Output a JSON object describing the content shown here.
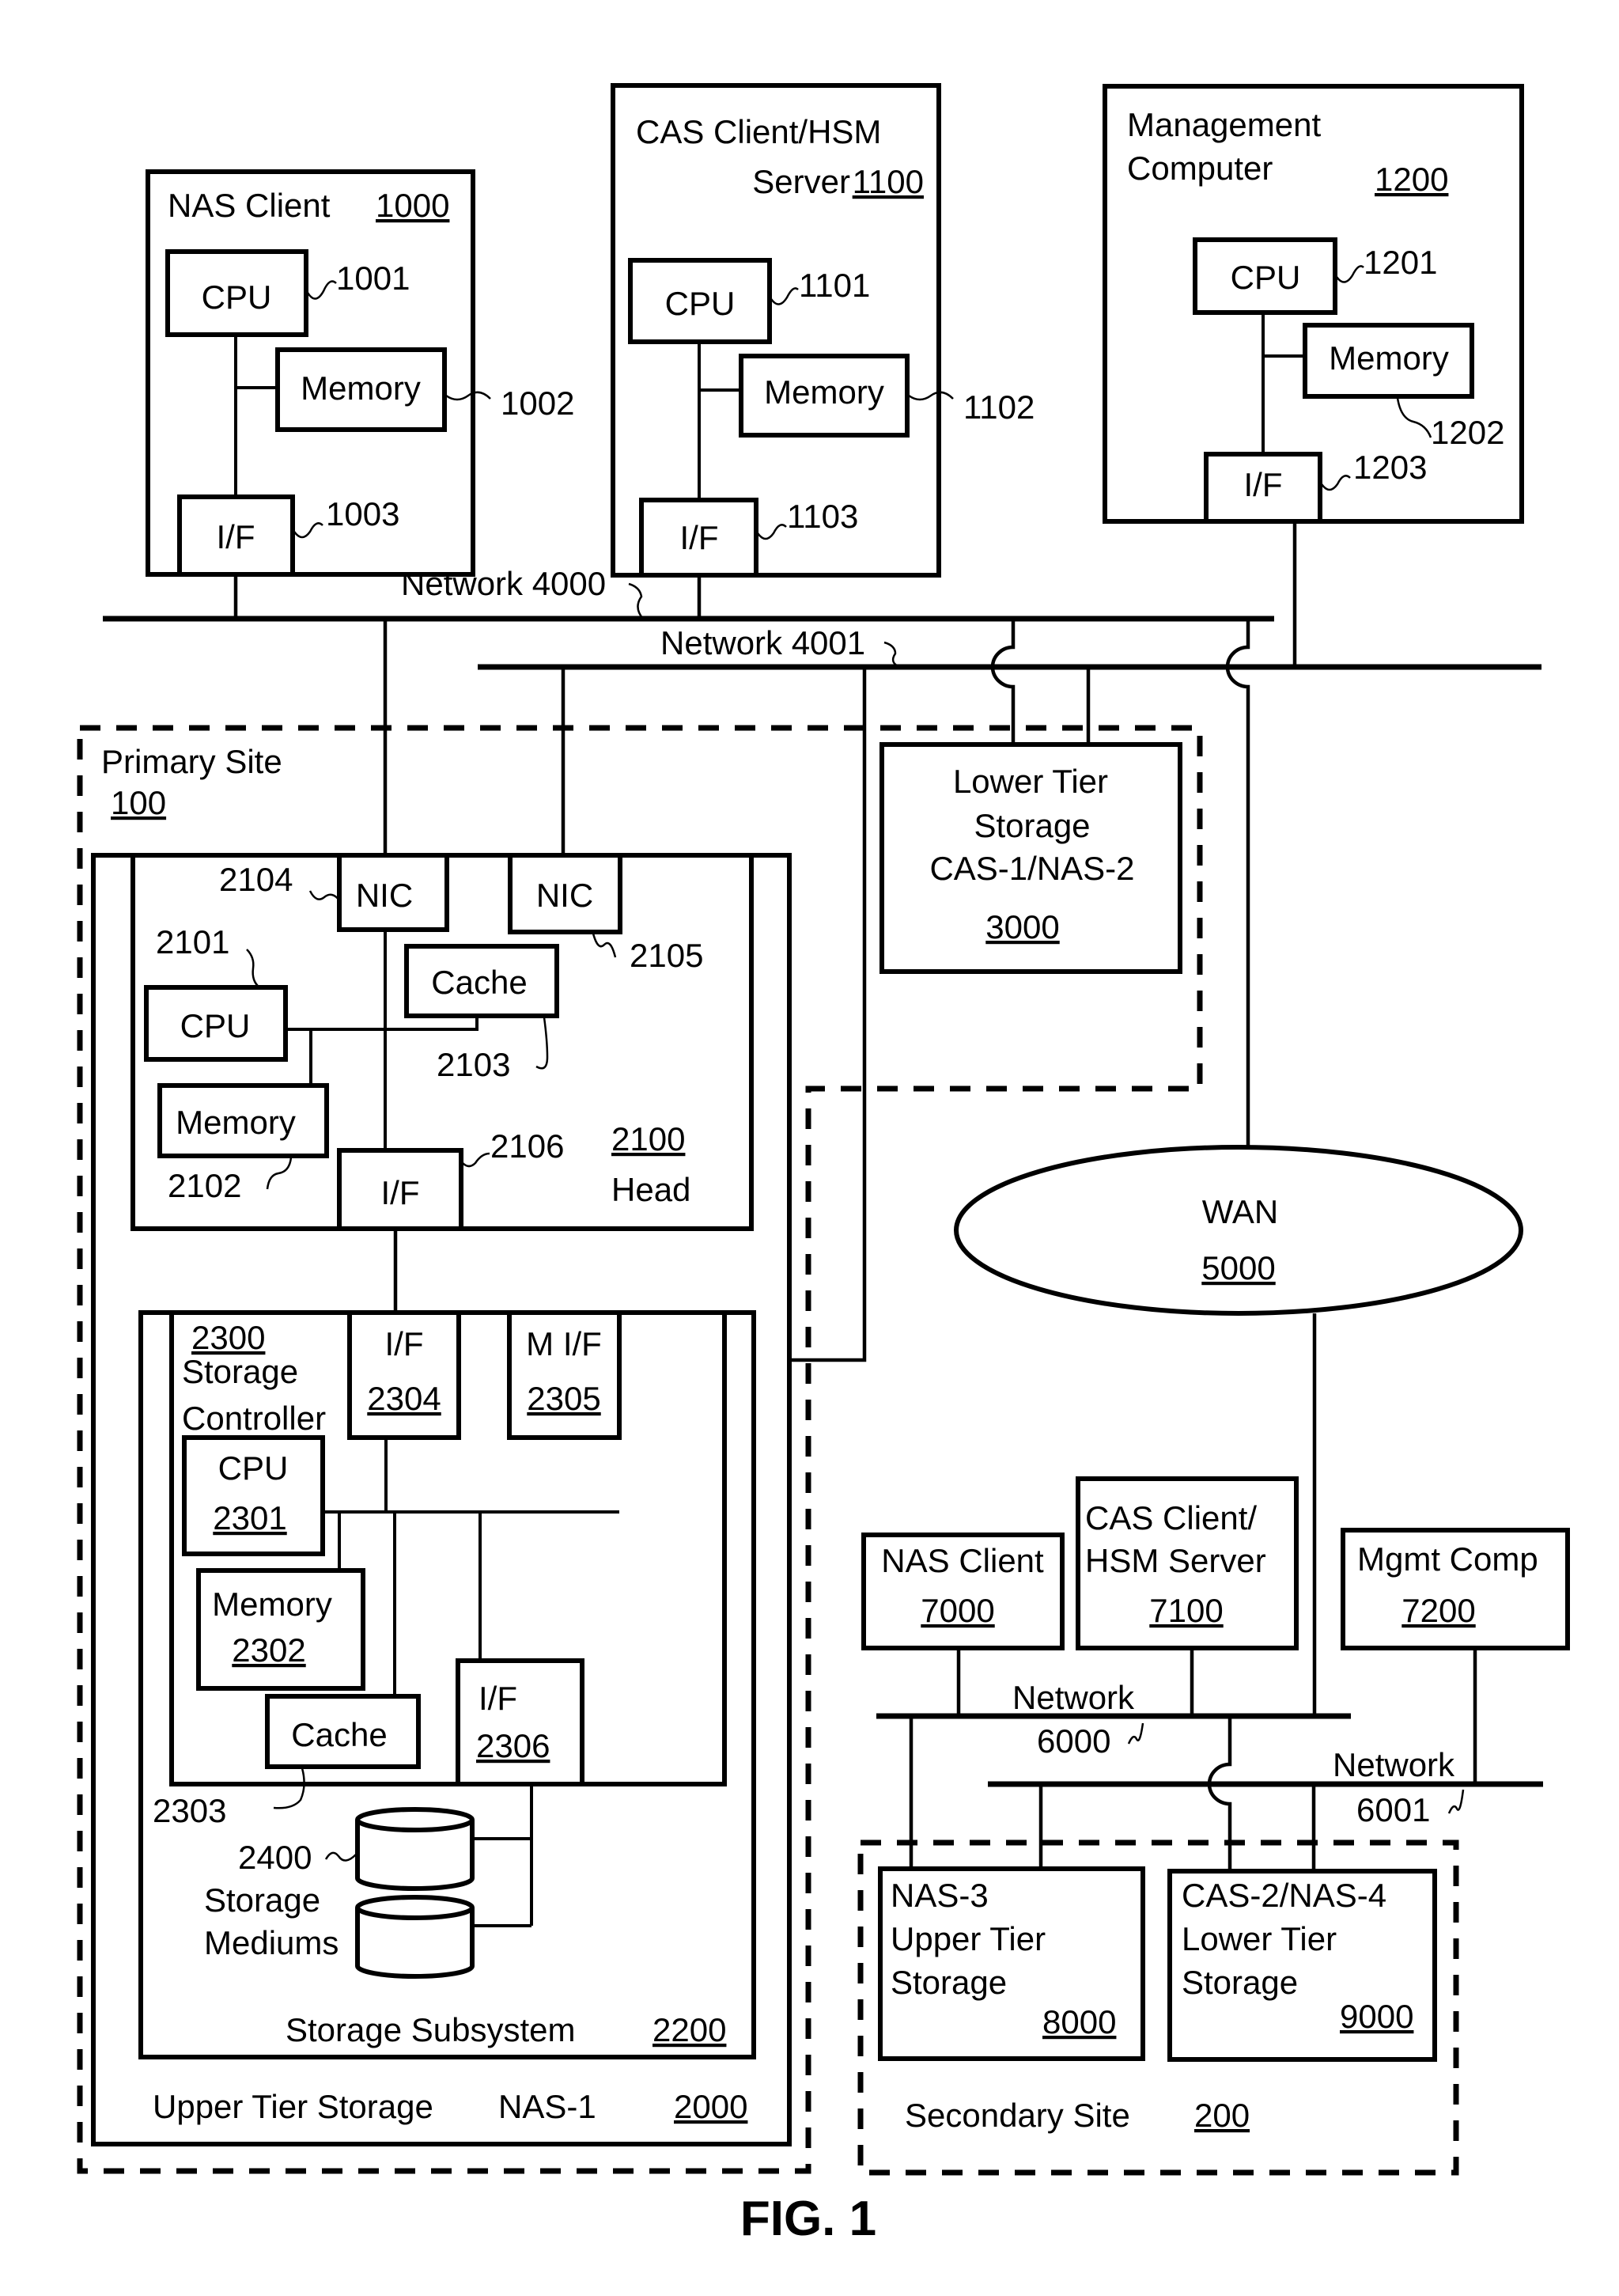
{
  "figure_title": "FIG. 1",
  "nas_client": {
    "title": "NAS Client",
    "ref": "1000",
    "cpu": {
      "label": "CPU",
      "ref": "1001"
    },
    "memory": {
      "label": "Memory",
      "ref": "1002"
    },
    "interface": {
      "label": "I/F",
      "ref": "1003"
    }
  },
  "cas_client": {
    "title_line1": "CAS Client/HSM",
    "title_line2": "Server",
    "ref": "1100",
    "cpu": {
      "label": "CPU",
      "ref": "1101"
    },
    "memory": {
      "label": "Memory",
      "ref": "1102"
    },
    "interface": {
      "label": "I/F",
      "ref": "1103"
    }
  },
  "management_computer": {
    "title_line1": "Management",
    "title_line2": "Computer",
    "ref": "1200",
    "cpu": {
      "label": "CPU",
      "ref": "1201"
    },
    "memory": {
      "label": "Memory",
      "ref": "1202"
    },
    "interface": {
      "label": "I/F",
      "ref": "1203"
    }
  },
  "networks": {
    "n4000": "Network 4000",
    "n4001": "Network 4001",
    "n6000_label": "Network",
    "n6000_ref": "6000",
    "n6001_label": "Network",
    "n6001_ref": "6001"
  },
  "primary_site": {
    "title": "Primary Site",
    "ref": "100",
    "upper_tier": {
      "title": "Upper Tier Storage",
      "name": "NAS-1",
      "ref": "2000",
      "head": {
        "title": "Head",
        "ref": "2100",
        "nic1": {
          "label": "NIC",
          "ref": "2104"
        },
        "nic2": {
          "label": "NIC",
          "ref": "2105"
        },
        "cpu": {
          "label": "CPU",
          "ref": "2101"
        },
        "memory": {
          "label": "Memory",
          "ref": "2102"
        },
        "cache": {
          "label": "Cache",
          "ref": "2103"
        },
        "interface": {
          "label": "I/F",
          "ref": "2106"
        }
      },
      "storage_subsystem": {
        "title": "Storage Subsystem",
        "ref": "2200",
        "controller": {
          "ref": "2300",
          "title_line1": "Storage",
          "title_line2": "Controller",
          "interface": {
            "label": "I/F",
            "ref": "2304"
          },
          "mgmt_interface": {
            "label": "M I/F",
            "ref": "2305"
          },
          "cpu": {
            "label": "CPU",
            "ref": "2301"
          },
          "memory": {
            "label": "Memory",
            "ref": "2302"
          },
          "cache": {
            "label": "Cache",
            "ref": "2303"
          },
          "disk_interface": {
            "label": "I/F",
            "ref": "2306"
          }
        },
        "mediums": {
          "ref": "2400",
          "label_line1": "Storage",
          "label_line2": "Mediums"
        }
      }
    },
    "lower_tier": {
      "line1": "Lower Tier",
      "line2": "Storage",
      "line3": "CAS-1/NAS-2",
      "ref": "3000"
    }
  },
  "wan": {
    "label": "WAN",
    "ref": "5000"
  },
  "secondary_site": {
    "title": "Secondary Site",
    "ref": "200",
    "nas_client": {
      "label": "NAS Client",
      "ref": "7000"
    },
    "cas_client": {
      "line1": "CAS Client/",
      "line2": "HSM Server",
      "ref": "7100"
    },
    "mgmt": {
      "label": "Mgmt Comp",
      "ref": "7200"
    },
    "upper_tier": {
      "line1": "NAS-3",
      "line2": "Upper Tier",
      "line3": "Storage",
      "ref": "8000"
    },
    "lower_tier": {
      "line1": "CAS-2/NAS-4",
      "line2": "Lower Tier",
      "line3": "Storage",
      "ref": "9000"
    }
  }
}
